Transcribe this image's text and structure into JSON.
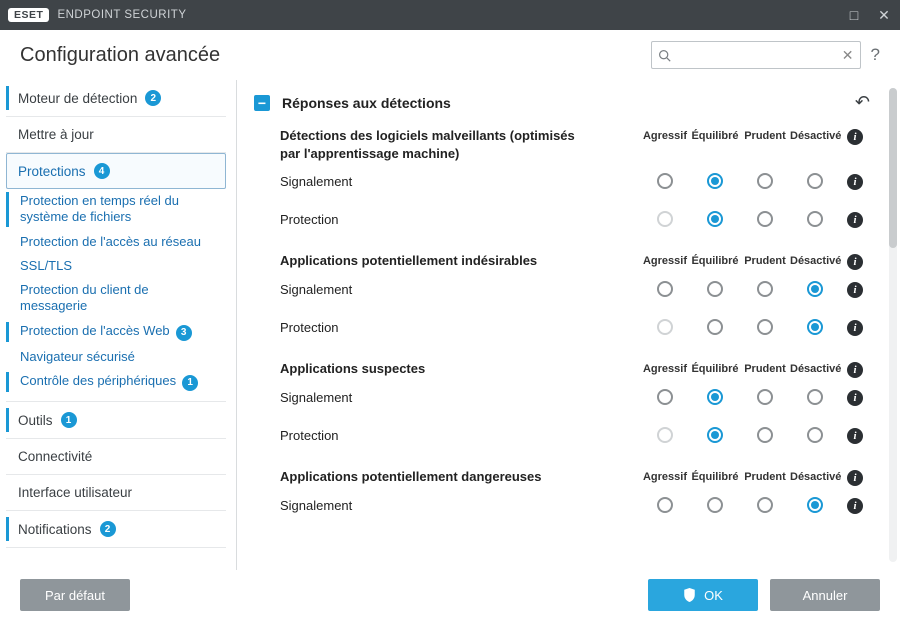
{
  "titlebar": {
    "brand": "ESET",
    "product": "ENDPOINT SECURITY"
  },
  "header": {
    "title": "Configuration avancée",
    "search_placeholder": "",
    "help": "?"
  },
  "sidebar": {
    "items": [
      {
        "key": "detection",
        "label": "Moteur de détection",
        "badge": "2",
        "bar": true
      },
      {
        "key": "update",
        "label": "Mettre à jour"
      },
      {
        "key": "protections",
        "label": "Protections",
        "badge": "4",
        "active": true,
        "sub": [
          {
            "key": "rtfs",
            "label": "Protection en temps réel du système de fichiers",
            "bar": true
          },
          {
            "key": "net",
            "label": "Protection de l'accès au réseau"
          },
          {
            "key": "ssl",
            "label": "SSL/TLS"
          },
          {
            "key": "mail",
            "label": "Protection du client de messagerie"
          },
          {
            "key": "web",
            "label": "Protection de l'accès Web",
            "badge": "3",
            "bar": true
          },
          {
            "key": "browser",
            "label": "Navigateur sécurisé"
          },
          {
            "key": "devctl",
            "label": "Contrôle des périphériques",
            "badge": "1",
            "bar": true
          }
        ]
      },
      {
        "key": "tools",
        "label": "Outils",
        "badge": "1",
        "bar": true
      },
      {
        "key": "connectivity",
        "label": "Connectivité"
      },
      {
        "key": "ui",
        "label": "Interface utilisateur"
      },
      {
        "key": "notifications",
        "label": "Notifications",
        "badge": "2",
        "bar": true
      }
    ]
  },
  "panel": {
    "title": "Réponses aux détections",
    "columns": [
      "Agressif",
      "Équilibré",
      "Prudent",
      "Désactivé"
    ],
    "row_labels": {
      "reporting": "Signalement",
      "protection": "Protection"
    },
    "sections": [
      {
        "title": "Détections des logiciels malveillants (optimisés par l'apprentissage machine)",
        "rows": [
          {
            "kind": "reporting",
            "selected": 1,
            "disabled": []
          },
          {
            "kind": "protection",
            "selected": 1,
            "disabled": [
              0
            ]
          }
        ]
      },
      {
        "title": "Applications potentiellement indésirables",
        "rows": [
          {
            "kind": "reporting",
            "selected": 3,
            "disabled": []
          },
          {
            "kind": "protection",
            "selected": 3,
            "disabled": [
              0
            ]
          }
        ]
      },
      {
        "title": "Applications suspectes",
        "rows": [
          {
            "kind": "reporting",
            "selected": 1,
            "disabled": []
          },
          {
            "kind": "protection",
            "selected": 1,
            "disabled": [
              0
            ]
          }
        ]
      },
      {
        "title": "Applications potentiellement dangereuses",
        "rows": [
          {
            "kind": "reporting",
            "selected": 3,
            "disabled": []
          }
        ]
      }
    ]
  },
  "footer": {
    "default": "Par défaut",
    "ok": "OK",
    "cancel": "Annuler"
  }
}
